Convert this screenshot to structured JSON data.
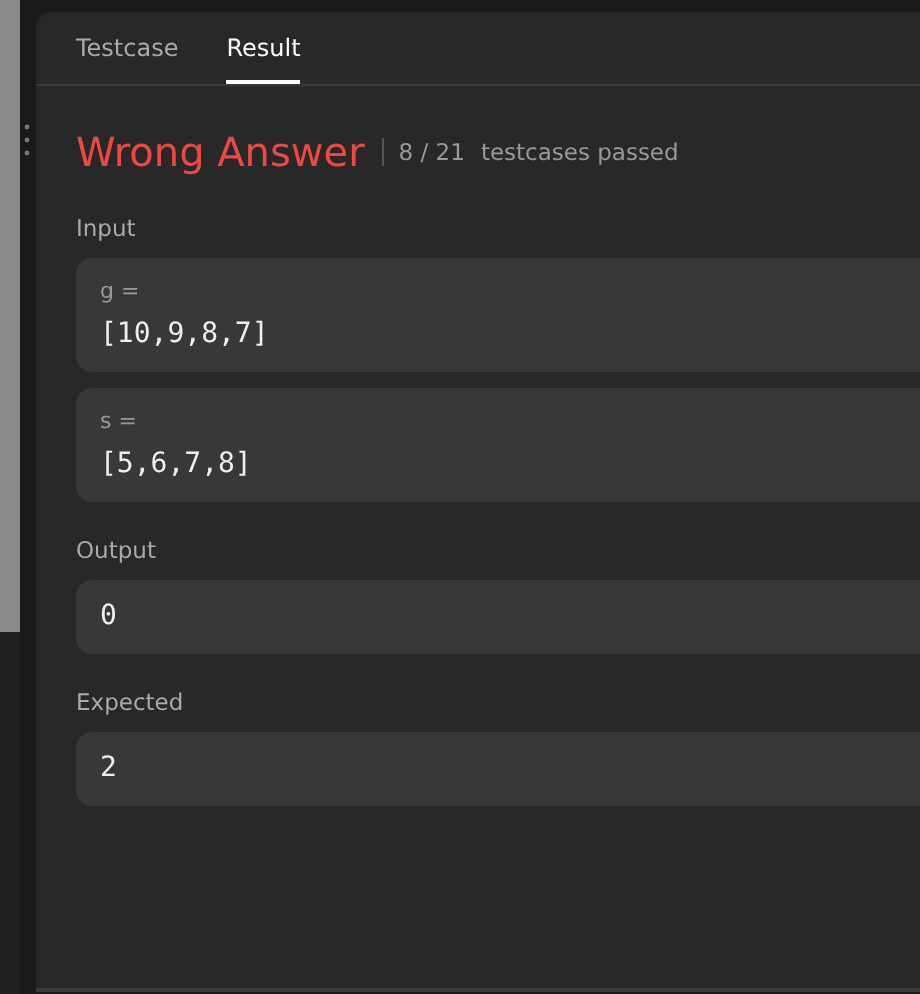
{
  "tabs": [
    {
      "label": "Testcase",
      "selected": false
    },
    {
      "label": "Result",
      "selected": true
    }
  ],
  "result": {
    "verdict": "Wrong Answer",
    "kind": "error",
    "passed": "8 / 21",
    "passed_label": "testcases passed"
  },
  "input": {
    "label": "Input",
    "params": [
      {
        "name": "g =",
        "value": "[10,9,8,7]"
      },
      {
        "name": "s =",
        "value": "[5,6,7,8]"
      }
    ]
  },
  "output": {
    "label": "Output",
    "value": "0"
  },
  "expected": {
    "label": "Expected",
    "value": "2"
  }
}
